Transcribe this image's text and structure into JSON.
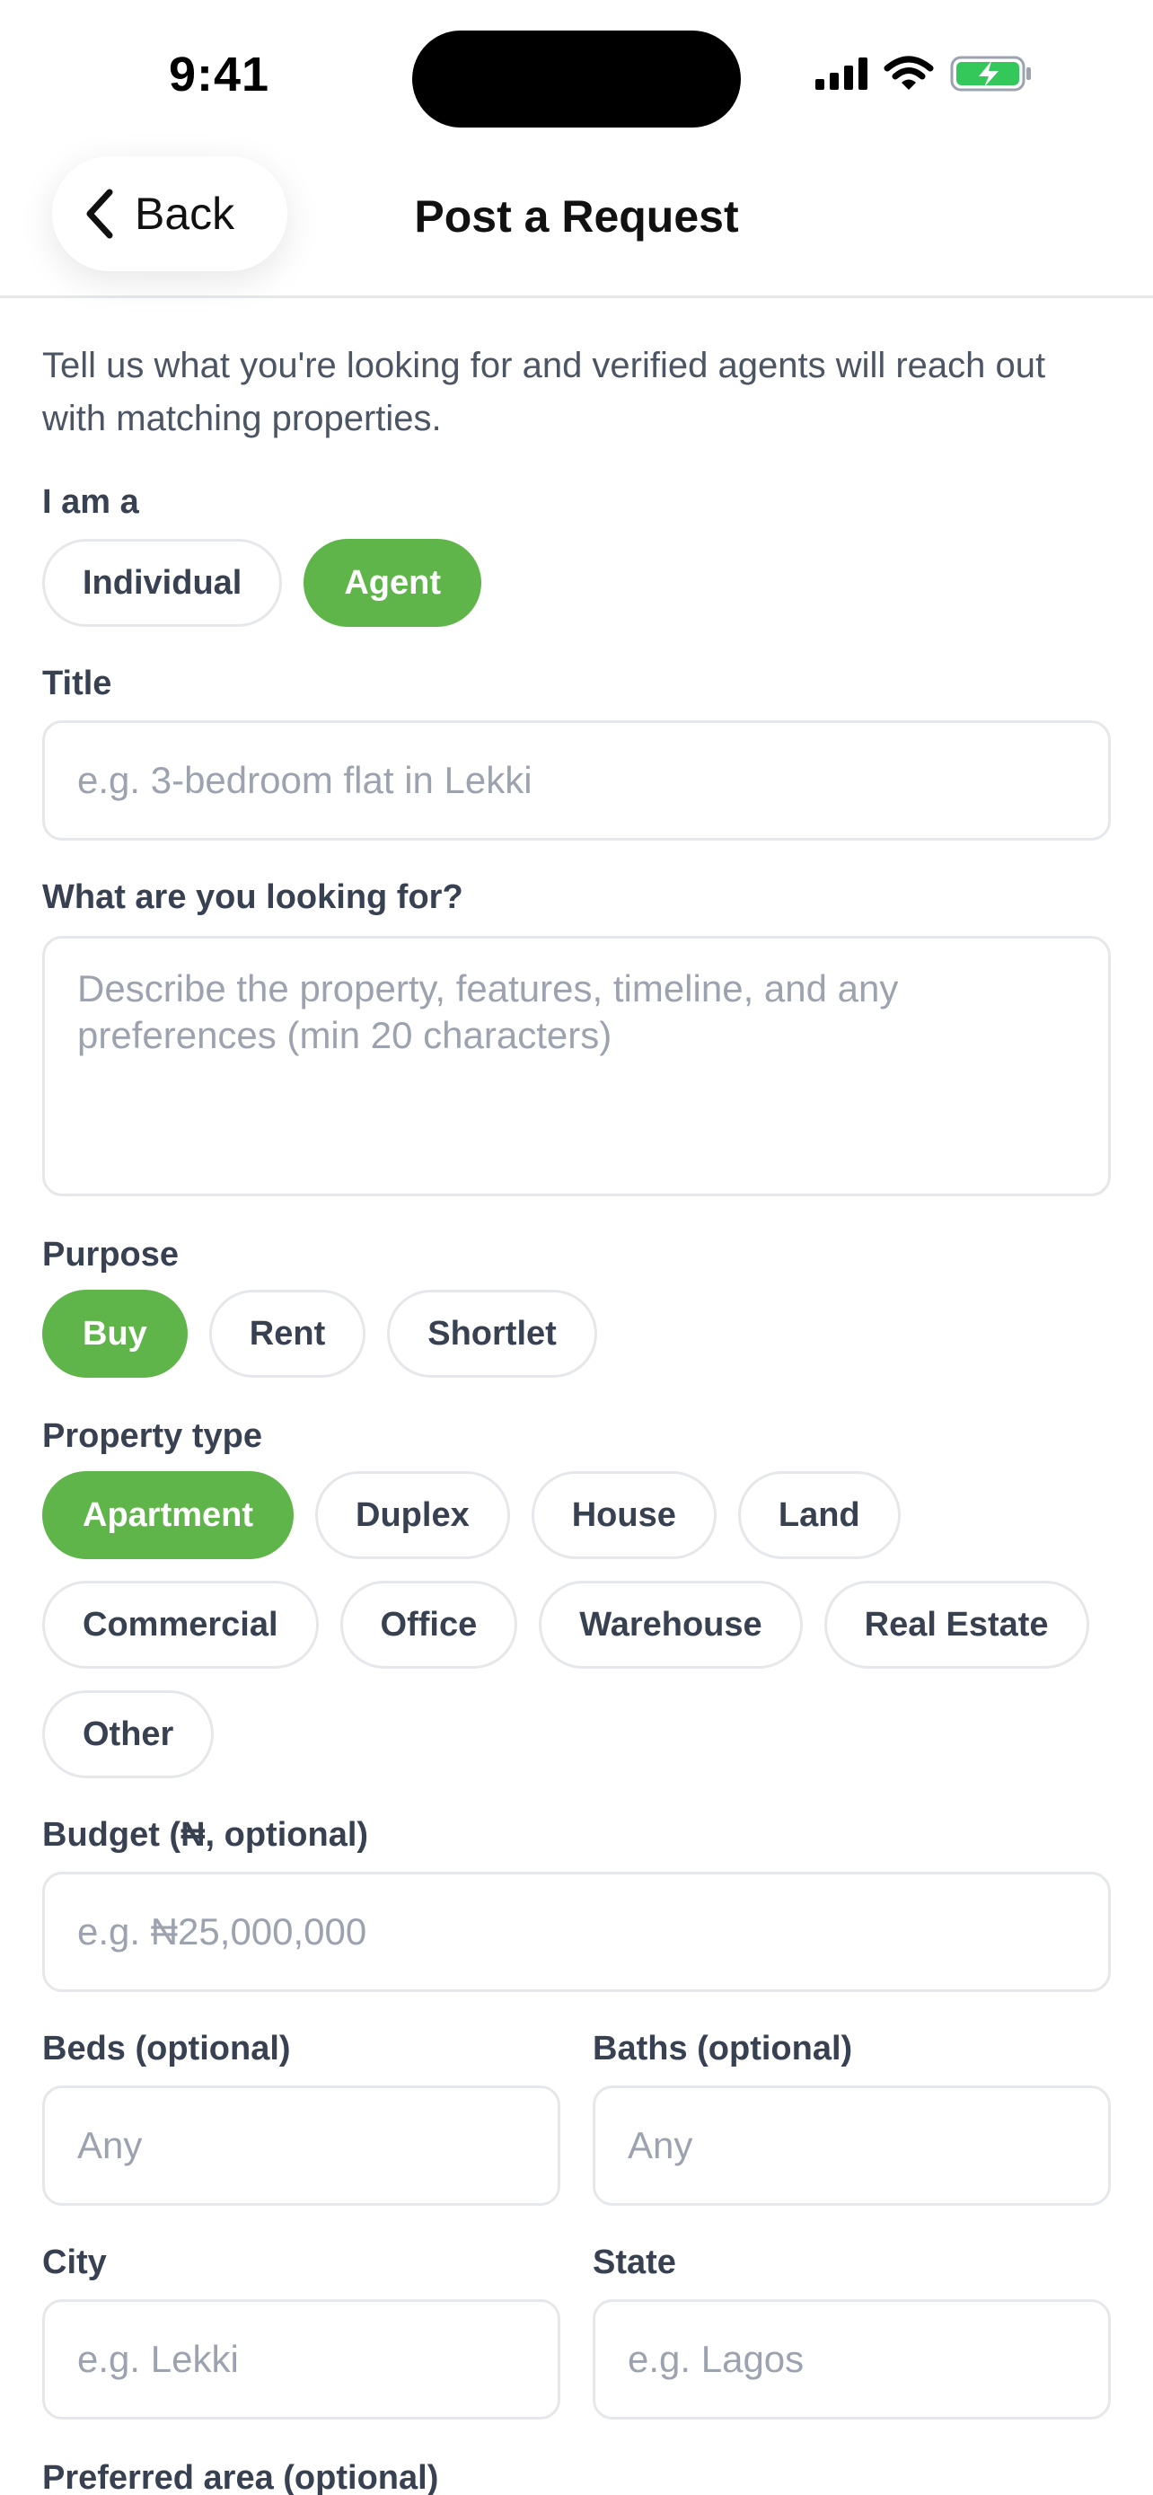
{
  "status": {
    "time": "9:41"
  },
  "nav": {
    "back_label": "Back",
    "title": "Post a Request"
  },
  "intro": "Tell us what you're looking for and verified agents will reach out with matching properties.",
  "role": {
    "label": "I am a",
    "options": [
      "Individual",
      "Agent"
    ],
    "selected": "Agent"
  },
  "title_field": {
    "label": "Title",
    "placeholder": "e.g. 3-bedroom flat in Lekki"
  },
  "looking_for": {
    "label": "What are you looking for?",
    "placeholder": "Describe the property, features, timeline, and any preferences (min 20 characters)"
  },
  "purpose": {
    "label": "Purpose",
    "options": [
      "Buy",
      "Rent",
      "Shortlet"
    ],
    "selected": "Buy"
  },
  "property_type": {
    "label": "Property type",
    "rows": [
      [
        "Apartment",
        "Duplex",
        "House",
        "Land"
      ],
      [
        "Commercial",
        "Office",
        "Warehouse",
        "Real Estate"
      ],
      [
        "Other"
      ]
    ],
    "selected": "Apartment"
  },
  "budget": {
    "label": "Budget (₦, optional)",
    "placeholder": "e.g. ₦25,000,000"
  },
  "beds": {
    "label": "Beds (optional)",
    "placeholder": "Any"
  },
  "baths": {
    "label": "Baths (optional)",
    "placeholder": "Any"
  },
  "city": {
    "label": "City",
    "placeholder": "e.g. Lekki"
  },
  "state": {
    "label": "State",
    "placeholder": "e.g. Lagos"
  },
  "preferred_area": {
    "label": "Preferred area (optional)"
  },
  "colors": {
    "accent": "#5fb54a",
    "border": "#e5e7eb",
    "placeholder": "#9ca3af",
    "battery": "#34c759"
  },
  "icons": [
    "signal-icon",
    "wifi-icon",
    "battery-charging-icon",
    "chevron-left-icon"
  ]
}
